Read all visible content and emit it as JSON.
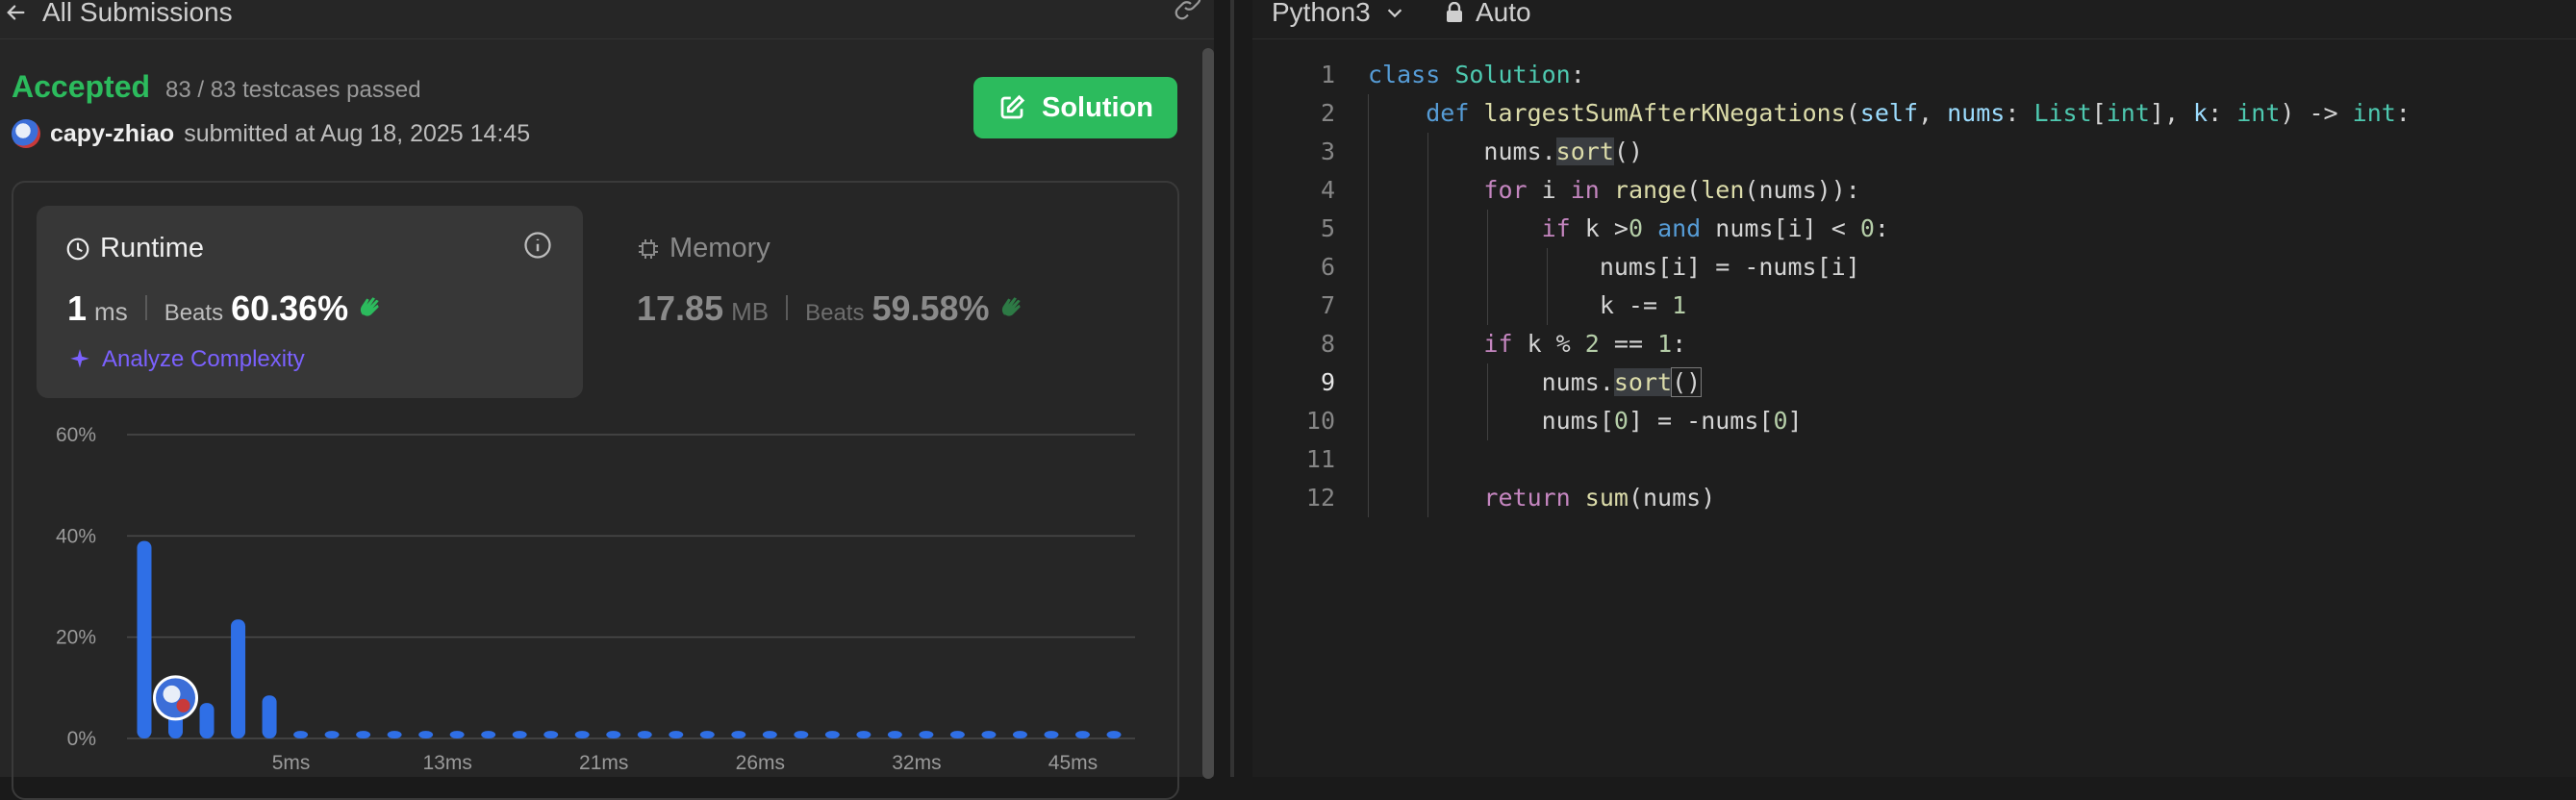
{
  "header": {
    "back_label": "All Submissions"
  },
  "status": {
    "accepted": "Accepted",
    "testcases": "83 / 83 testcases passed"
  },
  "submitter": {
    "user": "capy-zhiao",
    "text": "submitted at Aug 18, 2025 14:45"
  },
  "solution_button": "Solution",
  "runtime": {
    "title": "Runtime",
    "value": "1",
    "unit": "ms",
    "beats_label": "Beats",
    "beats": "60.36%",
    "analyze": "Analyze Complexity"
  },
  "memory": {
    "title": "Memory",
    "value": "17.85",
    "unit": "MB",
    "beats_label": "Beats",
    "beats": "59.58%"
  },
  "chart_data": {
    "type": "bar",
    "yticks": [
      "60%",
      "40%",
      "20%",
      "0%"
    ],
    "ylim": [
      0,
      60
    ],
    "xticks": [
      "5ms",
      "13ms",
      "21ms",
      "26ms",
      "32ms",
      "45ms"
    ],
    "values": [
      39,
      6.5,
      7,
      23.5,
      8.5,
      1.5,
      1.5,
      1.5,
      1.5,
      1.5,
      1.5,
      1.5,
      1.5,
      1.5,
      1.5,
      1.5,
      1.5,
      1.5,
      1.5,
      1.5,
      1.5,
      1.5,
      1.5,
      1.5,
      1.5,
      1.5,
      1.5,
      1.5,
      1.5,
      1.5,
      1.5,
      1.5
    ],
    "bar_color": "#2f6fe6",
    "highlight_index": 1
  },
  "editor": {
    "language": "Python3",
    "mode": "Auto",
    "active_line": 9
  },
  "code_lines": [
    "1",
    "2",
    "3",
    "4",
    "5",
    "6",
    "7",
    "8",
    "9",
    "10",
    "11",
    "12"
  ],
  "colors": {
    "accent": "#2cbb5d",
    "analyze": "#7b61ff"
  }
}
